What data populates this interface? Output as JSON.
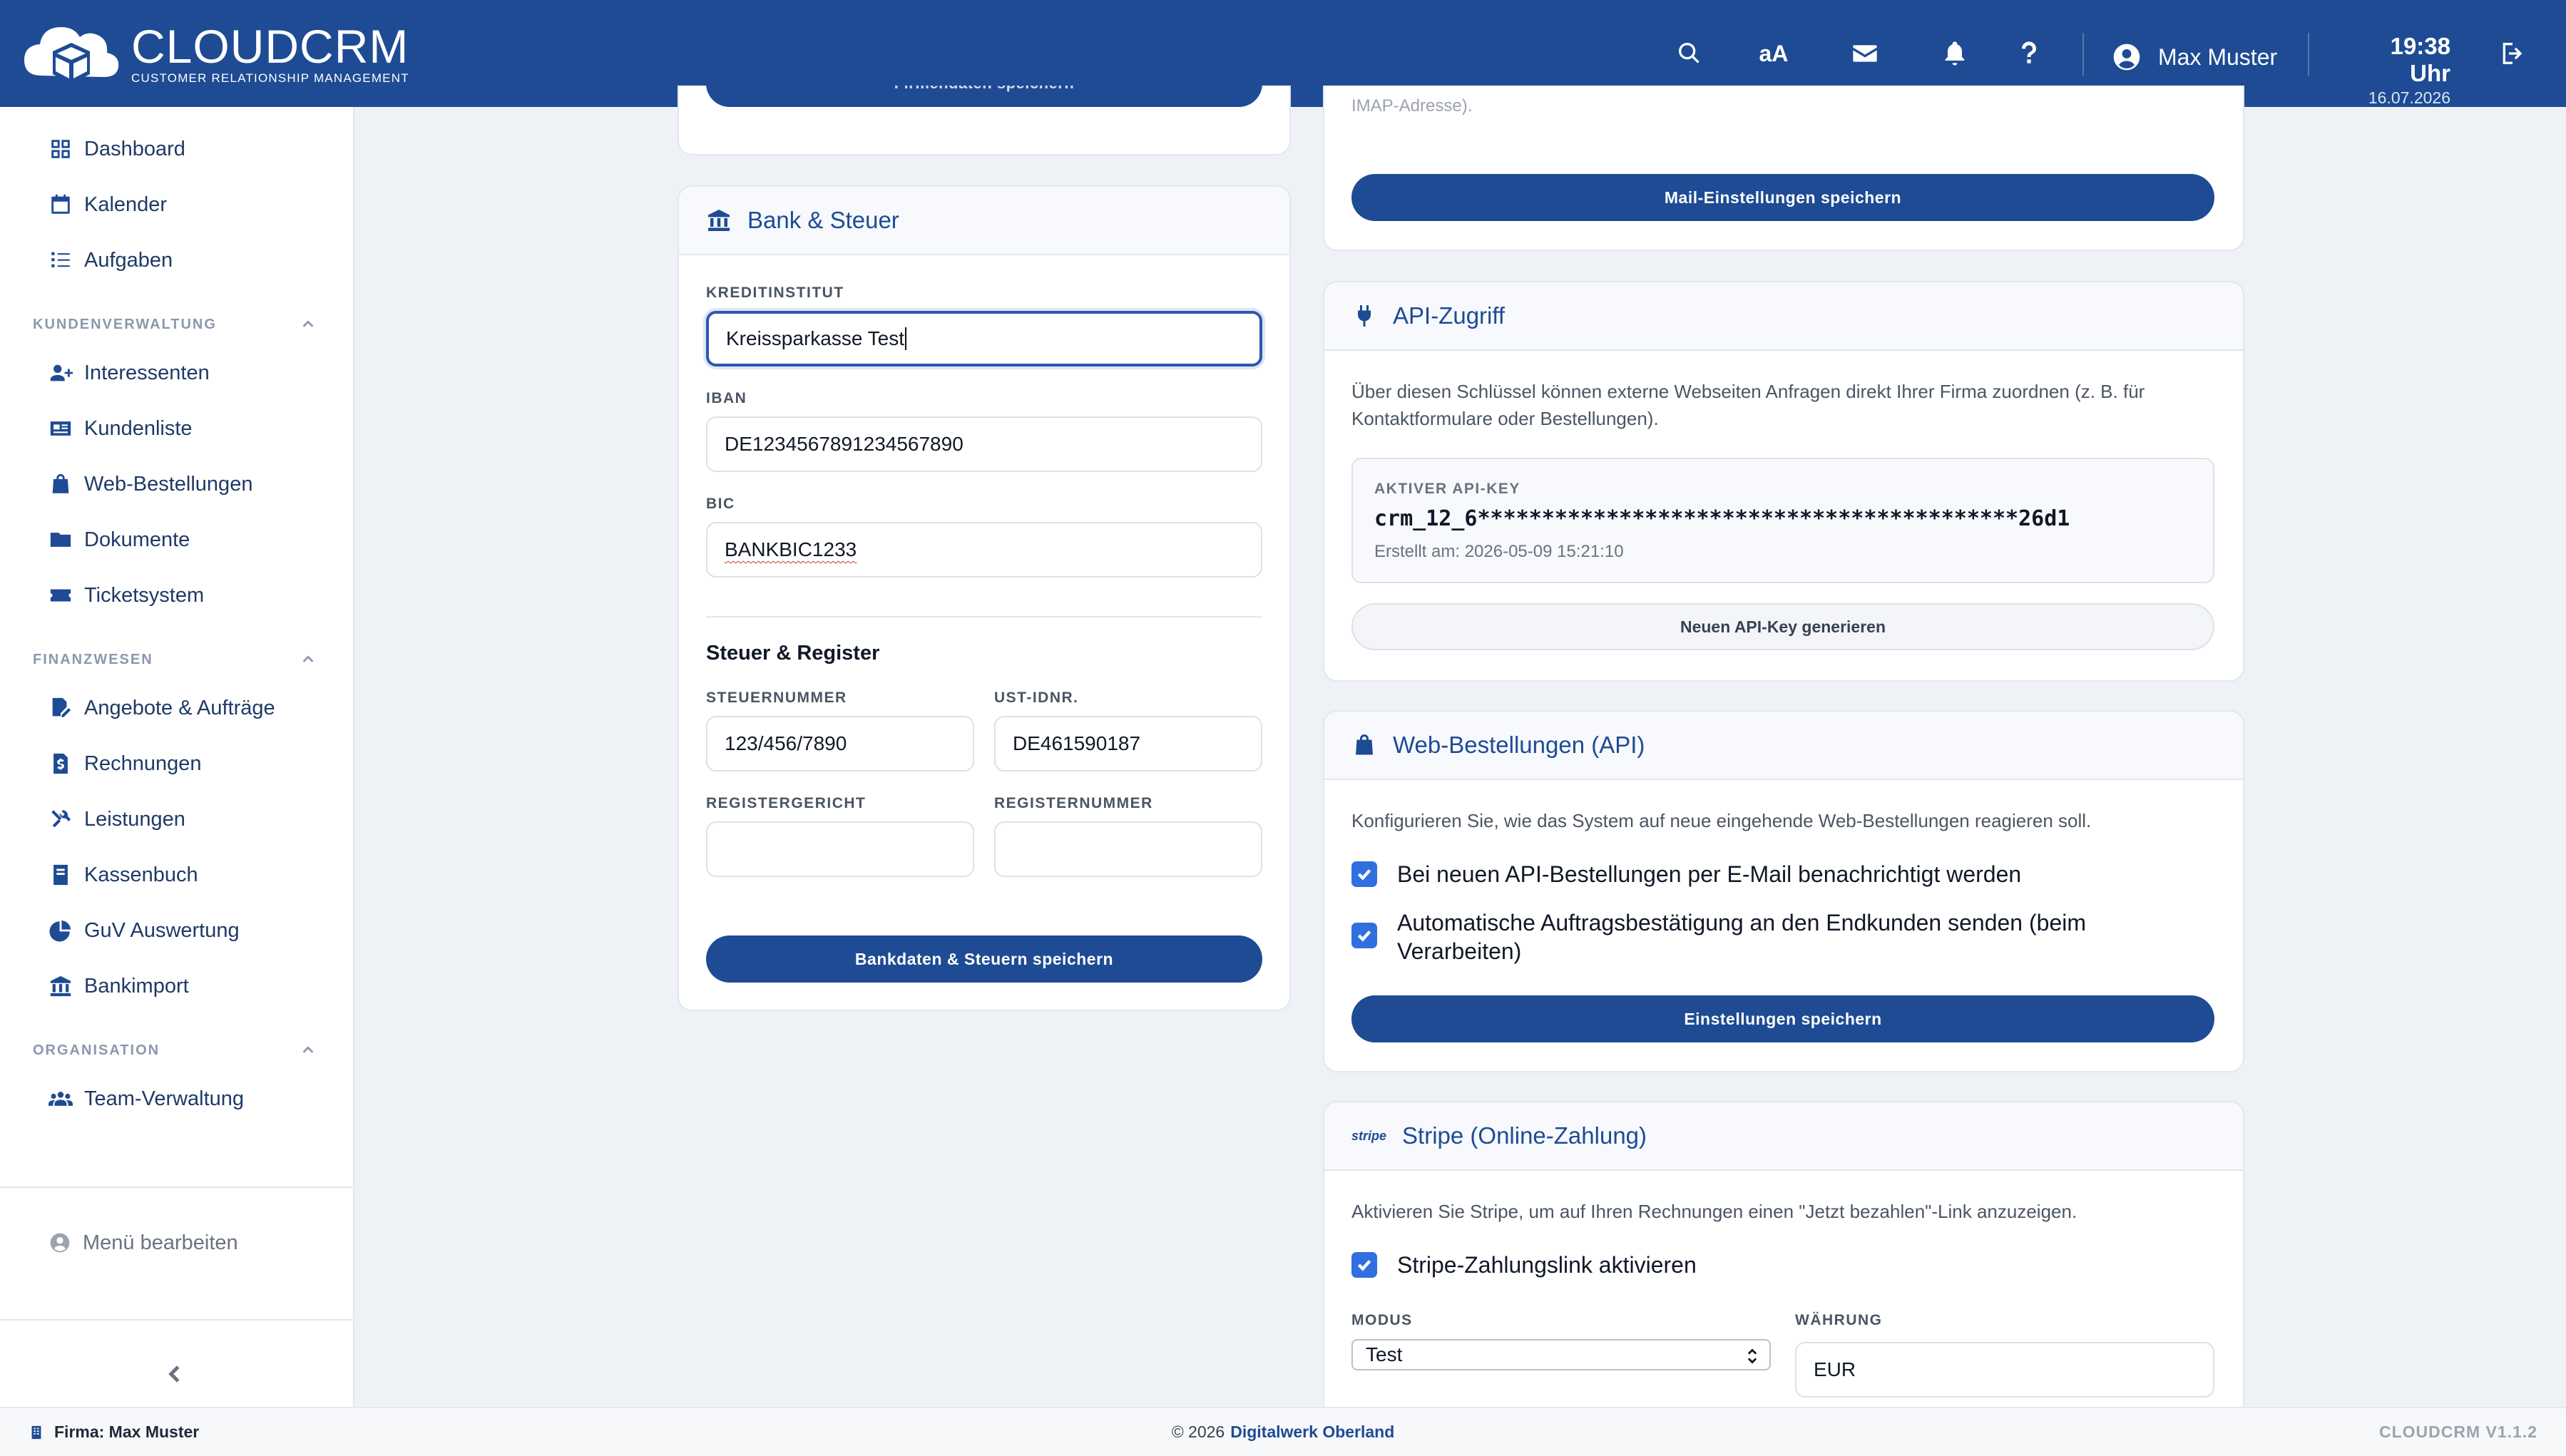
{
  "header": {
    "logo_name": "CLOUDCRM",
    "logo_sub": "CUSTOMER RELATIONSHIP MANAGEMENT",
    "font_size_label": "aA",
    "user_name": "Max Muster",
    "time": "19:38 Uhr",
    "date": "16.07.2026",
    "icons": [
      "search-icon",
      "font-size-icon",
      "mail-icon",
      "bell-icon",
      "help-icon",
      "user-circle-icon",
      "logout-icon"
    ]
  },
  "sidebar": {
    "top_items": [
      {
        "label": "Dashboard",
        "icon": "grid-icon"
      },
      {
        "label": "Kalender",
        "icon": "calendar-icon"
      },
      {
        "label": "Aufgaben",
        "icon": "tasks-icon"
      }
    ],
    "sections": [
      {
        "title": "KUNDENVERWALTUNG",
        "items": [
          {
            "label": "Interessenten",
            "icon": "user-plus-icon"
          },
          {
            "label": "Kundenliste",
            "icon": "id-card-icon"
          },
          {
            "label": "Web-Bestellungen",
            "icon": "bag-icon"
          },
          {
            "label": "Dokumente",
            "icon": "folder-icon"
          },
          {
            "label": "Ticketsystem",
            "icon": "ticket-icon"
          }
        ]
      },
      {
        "title": "FINANZWESEN",
        "items": [
          {
            "label": "Angebote & Aufträge",
            "icon": "file-edit-icon"
          },
          {
            "label": "Rechnungen",
            "icon": "invoice-icon"
          },
          {
            "label": "Leistungen",
            "icon": "tools-icon"
          },
          {
            "label": "Kassenbuch",
            "icon": "book-icon"
          },
          {
            "label": "GuV Auswertung",
            "icon": "pie-chart-icon"
          },
          {
            "label": "Bankimport",
            "icon": "bank-icon"
          }
        ]
      },
      {
        "title": "ORGANISATION",
        "items": [
          {
            "label": "Team-Verwaltung",
            "icon": "team-icon"
          }
        ]
      }
    ],
    "menu_edit": "Menü bearbeiten"
  },
  "top_left_card": {
    "button_label": "Firmendaten speichern"
  },
  "bank_card": {
    "title": "Bank & Steuer",
    "kreditinstitut_label": "KREDITINSTITUT",
    "kreditinstitut_value": "Kreissparkasse Test",
    "iban_label": "IBAN",
    "iban_value": "DE1234567891234567890",
    "bic_label": "BIC",
    "bic_value": "BANKBIC1233",
    "steuer_heading": "Steuer & Register",
    "steuernummer_label": "STEUERNUMMER",
    "steuernummer_value": "123/456/7890",
    "ustid_label": "UST-IDNR.",
    "ustid_value": "DE461590187",
    "registergericht_label": "REGISTERGERICHT",
    "registergericht_value": "",
    "registernummer_label": "REGISTERNUMMER",
    "registernummer_value": "",
    "save_button": "Bankdaten & Steuern speichern"
  },
  "mail_card": {
    "partial_text": "IMAP-Adresse).",
    "save_button": "Mail-Einstellungen speichern"
  },
  "api_card": {
    "title": "API-Zugriff",
    "description": "Über diesen Schlüssel können externe Webseiten Anfragen direkt Ihrer Firma zuordnen (z. B. für Kontaktformulare oder Bestellungen).",
    "key_label": "AKTIVER API-KEY",
    "key_value": "crm_12_6******************************************26d1",
    "created": "Erstellt am: 2026-05-09 15:21:10",
    "generate_button": "Neuen API-Key generieren"
  },
  "web_orders_card": {
    "title": "Web-Bestellungen (API)",
    "description": "Konfigurieren Sie, wie das System auf neue eingehende Web-Bestellungen reagieren soll.",
    "option1": "Bei neuen API-Bestellungen per E-Mail benachrichtigt werden",
    "option1_checked": true,
    "option2": "Automatische Auftragsbestätigung an den Endkunden senden (beim Verarbeiten)",
    "option2_checked": true,
    "save_button": "Einstellungen speichern"
  },
  "stripe_card": {
    "logo_text": "stripe",
    "title": "Stripe (Online-Zahlung)",
    "description": "Aktivieren Sie Stripe, um auf Ihren Rechnungen einen \"Jetzt bezahlen\"-Link anzuzeigen.",
    "enable_label": "Stripe-Zahlungslink aktivieren",
    "enable_checked": true,
    "mode_label": "MODUS",
    "mode_value": "Test",
    "currency_label": "WÄHRUNG",
    "currency_value": "EUR"
  },
  "footer": {
    "company": "Firma: Max Muster",
    "copyright": "© 2026",
    "copyright_link": "Digitalwerk Oberland",
    "version": "CLOUDCRM V1.1.2"
  },
  "colors": {
    "primary": "#1e4b94",
    "focus": "#2f56b5",
    "checkbox": "#2f6fe0"
  }
}
